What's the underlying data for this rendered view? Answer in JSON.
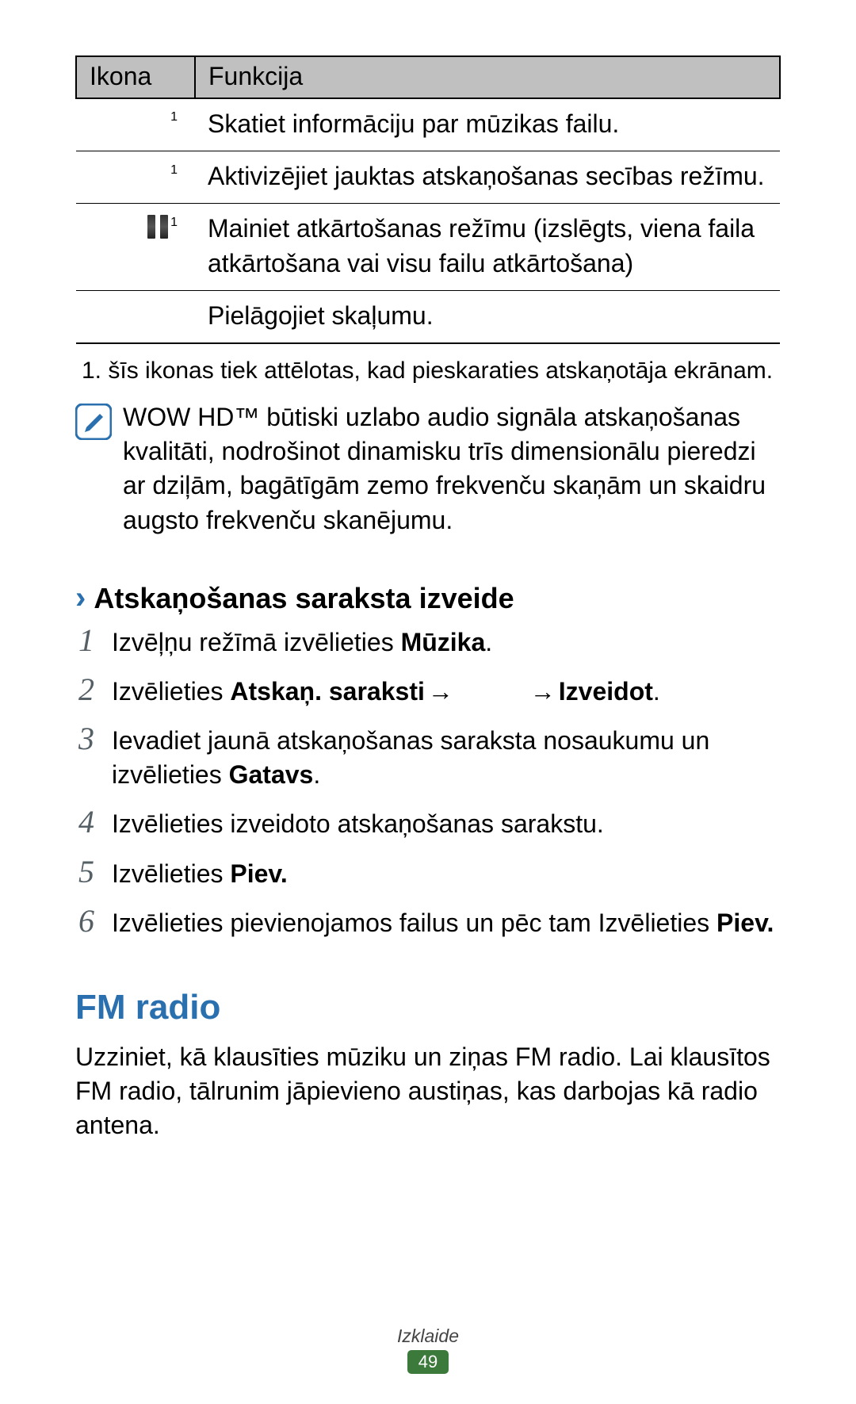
{
  "table": {
    "header_icon": "Ikona",
    "header_func": "Funkcija",
    "rows": [
      {
        "sup": "1",
        "func": "Skatiet informāciju par mūzikas failu."
      },
      {
        "sup": "1",
        "func": "Aktivizējiet jauktas atskaņošanas secības režīmu."
      },
      {
        "sup": "1",
        "func": "Mainiet atkārtošanas režīmu (izslēgts, viena faila atkārtošana vai visu failu atkārtošana)"
      },
      {
        "sup": "",
        "func": "Pielāgojiet skaļumu."
      }
    ]
  },
  "footnote": "1.  šīs ikonas tiek attēlotas, kad pieskaraties atskaņotāja ekrānam.",
  "note_text": "WOW HD™ būtiski uzlabo audio signāla atskaņošanas kvalitāti, nodrošinot dinamisku trīs dimensionālu pieredzi ar dziļām, bagātīgām zemo frekvenču skaņām un skaidru augsto frekvenču skanējumu.",
  "sub_heading": "Atskaņošanas saraksta izveide",
  "steps": {
    "s1": {
      "pre": "Izvēļņu režīmā izvēlieties ",
      "b1": "Mūzika",
      "post": "."
    },
    "s2": {
      "pre": "Izvēlieties ",
      "b1": "Atskaņ. saraksti",
      "arrow": " → ",
      "gap": "          ",
      "arrow2": "→ ",
      "b2": "Izveidot",
      "post": "."
    },
    "s3": {
      "pre": "Ievadiet jaunā atskaņošanas saraksta nosaukumu un izvēlieties ",
      "b1": "Gatavs",
      "post": "."
    },
    "s4": {
      "text": "Izvēlieties izveidoto atskaņošanas sarakstu."
    },
    "s5": {
      "pre": "Izvēlieties ",
      "b1": "Piev."
    },
    "s6": {
      "pre": "Izvēlieties pievienojamos failus un pēc tam Izvēlieties ",
      "b1": "Piev."
    }
  },
  "h1": "FM radio",
  "fm_para": "Uzziniet, kā klausīties mūziku un ziņas FM radio. Lai klausītos FM radio, tālrunim jāpievieno austiņas, kas darbojas kā radio antena.",
  "footer": {
    "category": "Izklaide",
    "page": "49"
  }
}
